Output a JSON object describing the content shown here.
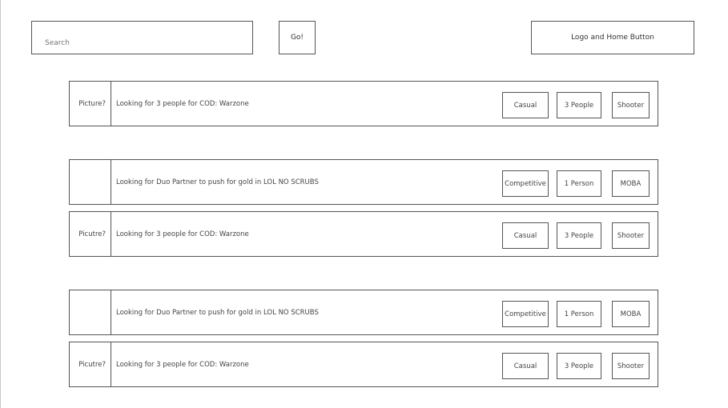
{
  "header": {
    "search_placeholder": "Search",
    "go_label": "Go!",
    "logo_home_label": "Logo and Home Button"
  },
  "posts": [
    {
      "picture_label": "Picture?",
      "description": "Looking for 3 people for COD: Warzone",
      "tags": {
        "style": "Casual",
        "people": "3 People",
        "genre": "Shooter"
      }
    },
    {
      "picture_label": "",
      "description": "Looking for Duo Partner to push for gold in LOL NO SCRUBS",
      "tags": {
        "style": "Competitive",
        "people": "1 Person",
        "genre": "MOBA"
      }
    },
    {
      "picture_label": "Picutre?",
      "description": "Looking for 3 people for COD: Warzone",
      "tags": {
        "style": "Casual",
        "people": "3 People",
        "genre": "Shooter"
      }
    },
    {
      "picture_label": "",
      "description": "Looking for Duo Partner to push for gold in LOL NO SCRUBS",
      "tags": {
        "style": "Competitive",
        "people": "1 Person",
        "genre": "MOBA"
      }
    },
    {
      "picture_label": "Picutre?",
      "description": "Looking for 3 people for COD: Warzone",
      "tags": {
        "style": "Casual",
        "people": "3 People",
        "genre": "Shooter"
      }
    }
  ],
  "colors": {
    "border": "#555555",
    "text": "#444444",
    "background": "#ffffff"
  }
}
